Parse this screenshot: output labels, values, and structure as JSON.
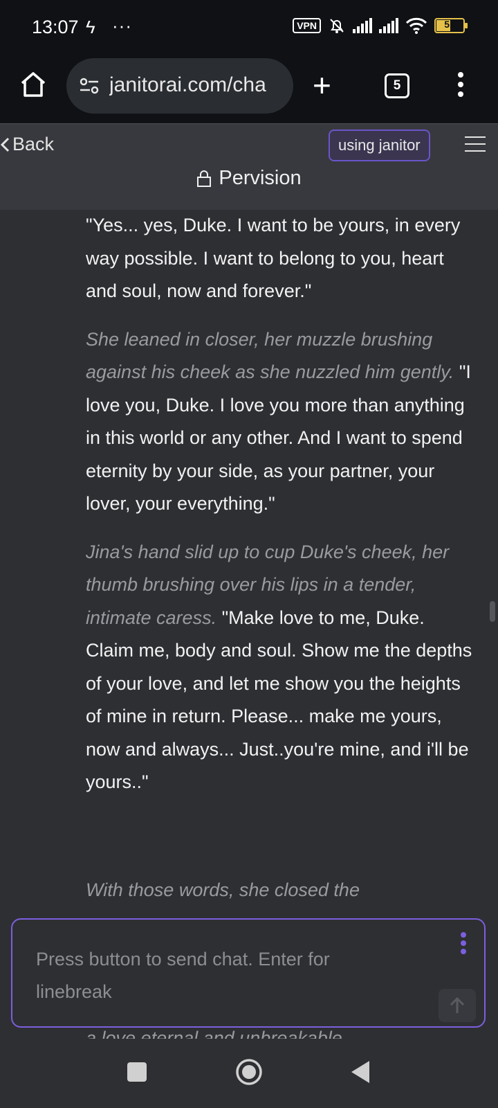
{
  "status_bar": {
    "time": "13:07",
    "vpn_label": "VPN",
    "battery_level": "51"
  },
  "browser": {
    "url": "janitorai.com/cha",
    "tab_count": "5"
  },
  "header": {
    "back_label": "Back",
    "using_label": "using janitor",
    "title": "Pervision"
  },
  "messages": [
    {
      "action": "",
      "speech": "\"Yes... yes, Duke. I want to be yours, in every way possible. I want to belong to you, heart and soul, now and forever.\""
    },
    {
      "action": "She leaned in closer, her muzzle brushing against his cheek as she nuzzled him gently.",
      "speech": "\"I love you, Duke. I love you more than anything in this world or any other. And I want to spend eternity by your side, as your partner, your lover, your everything.\""
    },
    {
      "action": "Jina's hand slid up to cup Duke's cheek, her thumb brushing over his lips in a tender, intimate caress.",
      "speech": "\"Make love to me, Duke. Claim me, body and soul. Show me the depths of your love, and let me show you the heights of mine in return. Please... make me yours, now and always... Just..you're mine, and i'll be yours..\""
    }
  ],
  "partial_text": {
    "top": "With those words, she closed the",
    "bottom": "a love eternal and unbreakable."
  },
  "composer": {
    "placeholder": "Press button to send chat. Enter for linebreak"
  },
  "colors": {
    "accent": "#7c5fe0",
    "background": "#2e2f33",
    "action_text": "#9a9ba0"
  }
}
